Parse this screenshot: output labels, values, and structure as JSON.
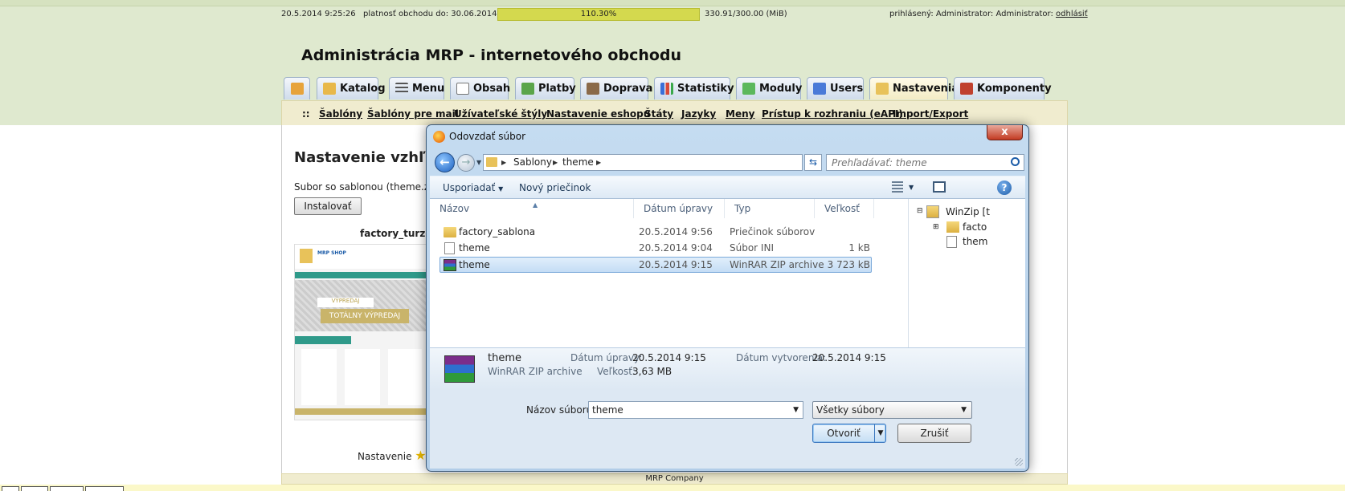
{
  "status": {
    "datetime": "20.5.2014 9:25:26",
    "validity": "platnosť obchodu do: 30.06.2014",
    "quota_percent": "110.30%",
    "quota_size": "330.91/300.00 (MiB)",
    "logged_in": "prihlásený: Administrator: Administrator:",
    "logout": "odhlásiť"
  },
  "header": {
    "title": "Administrácia MRP - internetového obchodu"
  },
  "tabs": [
    {
      "label": "",
      "icon": "home-icon"
    },
    {
      "label": "Katalog",
      "icon": "catalog-icon"
    },
    {
      "label": "Menu",
      "icon": "menu-icon"
    },
    {
      "label": "Obsah",
      "icon": "page-icon"
    },
    {
      "label": "Platby",
      "icon": "payment-icon"
    },
    {
      "label": "Doprava",
      "icon": "truck-icon"
    },
    {
      "label": "Statistiky",
      "icon": "chart-icon"
    },
    {
      "label": "Moduly",
      "icon": "puzzle-icon"
    },
    {
      "label": "Users",
      "icon": "users-icon"
    },
    {
      "label": "Nastavenia",
      "icon": "settings-icon"
    },
    {
      "label": "Komponenty",
      "icon": "components-icon"
    }
  ],
  "subnav": {
    "sep": "::",
    "items": [
      "Šablóny",
      "Šablóny pre mail",
      "Užívateľské štýly",
      "Nastavenie eshopu",
      "Štáty",
      "Jazyky",
      "Meny",
      "Prístup k rozhraniu (eAPI)",
      "Import/Export"
    ]
  },
  "page": {
    "heading": "Nastavenie vzhľad",
    "file_text": "Subor so sablonou (theme.zip",
    "install": "Instalovať",
    "theme_name": "factory_turzc",
    "thumb": {
      "shop": "MRP SHOP",
      "sale1": "VÝPREDAJ",
      "sale2": "TOTÁLNY VÝPREDAJ"
    },
    "setting": "Nastavenie",
    "footer": "MRP Company"
  },
  "dialog": {
    "title": "Odovzdať súbor",
    "close": "x",
    "address": [
      "Sablony",
      "theme"
    ],
    "search_placeholder": "Prehľadávať: theme",
    "toolbar": {
      "organize": "Usporiadať",
      "new_folder": "Nový priečinok"
    },
    "columns": {
      "name": "Názov",
      "date": "Dátum úpravy",
      "type": "Typ",
      "size": "Veľkosť"
    },
    "files": [
      {
        "name": "factory_sablona",
        "date": "20.5.2014 9:56",
        "type": "Priečinok súborov",
        "size": "",
        "icon": "folder-icon"
      },
      {
        "name": "theme",
        "date": "20.5.2014 9:04",
        "type": "Súbor INI",
        "size": "1 kB",
        "icon": "document-icon"
      },
      {
        "name": "theme",
        "date": "20.5.2014 9:15",
        "type": "WinRAR ZIP archive",
        "size": "3 723 kB",
        "icon": "rar-archive-icon"
      }
    ],
    "tree": {
      "root": "WinZip [t",
      "child1": "facto",
      "child2": "them"
    },
    "details": {
      "name": "theme",
      "type": "WinRAR ZIP archive",
      "modified_label": "Dátum úpravy:",
      "modified_value": "20.5.2014 9:15",
      "size_label": "Veľkosť:",
      "size_value": "3,63 MB",
      "created_label": "Dátum vytvorenia:",
      "created_value": "20.5.2014 9:15"
    },
    "filename_label": "Názov súboru:",
    "filename_value": "theme",
    "filter": "Všetky súbory",
    "open": "Otvoriť",
    "cancel": "Zrušiť"
  }
}
